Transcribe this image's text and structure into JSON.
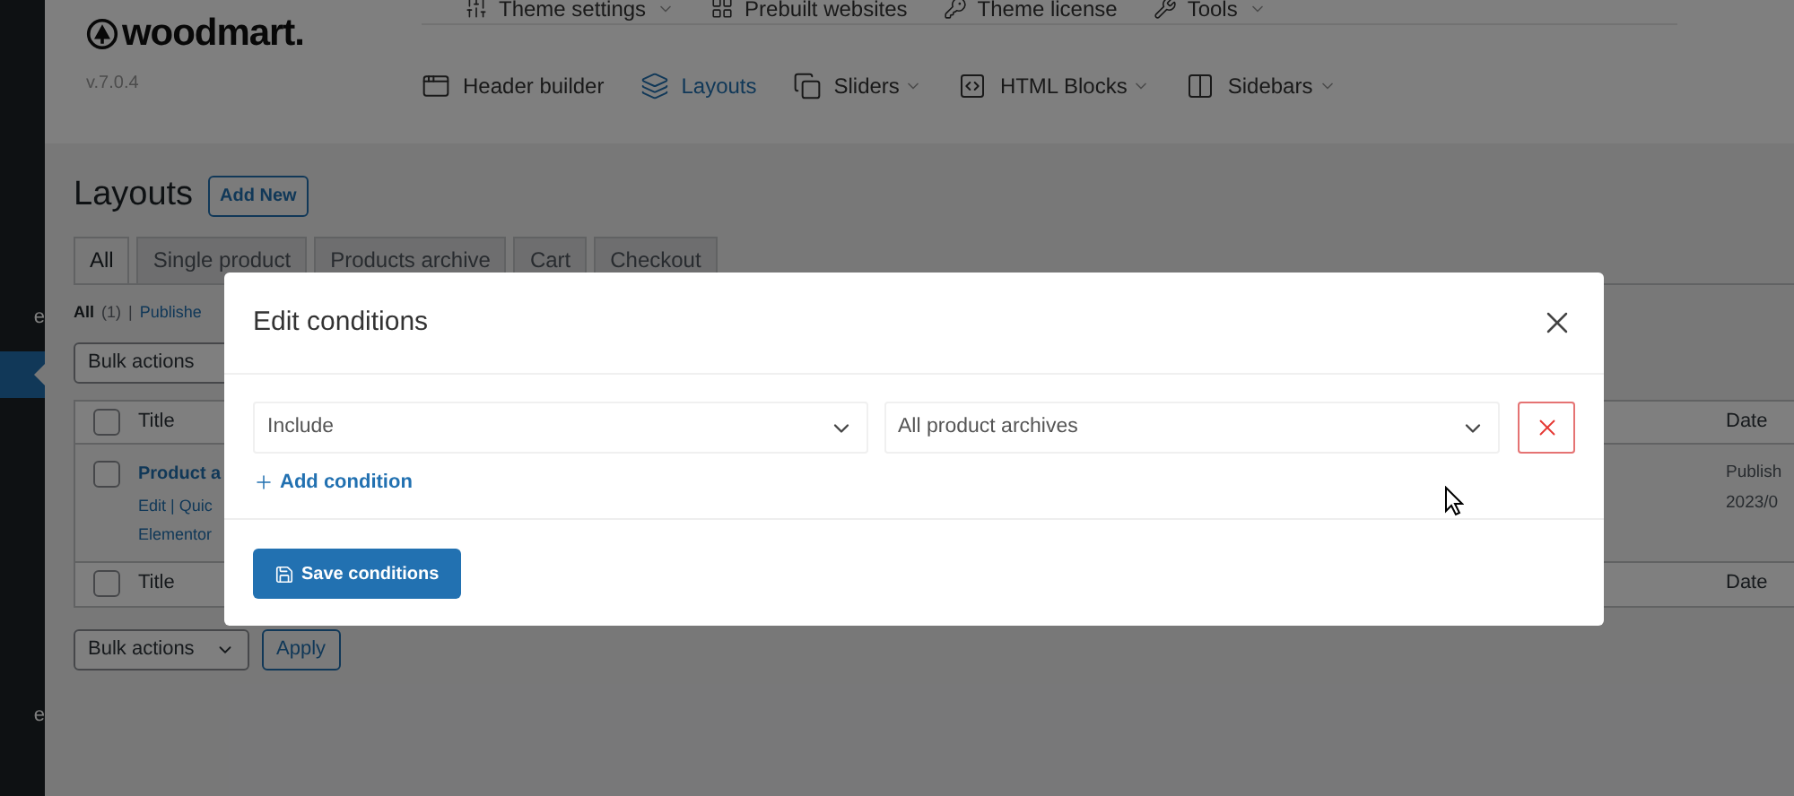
{
  "sidebar": {
    "items": [
      {
        "label": "e",
        "selected": false
      },
      {
        "selected": true
      },
      {
        "label": "e",
        "selected": false
      }
    ]
  },
  "top_menu": [
    {
      "label": "Theme settings",
      "dropdown": true
    },
    {
      "label": "Prebuilt websites",
      "dropdown": false
    },
    {
      "label": "Theme license",
      "dropdown": false
    },
    {
      "label": "Tools",
      "dropdown": true
    }
  ],
  "logo": {
    "name": "woodmart.",
    "version": "v.7.0.4"
  },
  "nav": [
    {
      "label": "Header builder",
      "dropdown": false,
      "selected": false
    },
    {
      "label": "Layouts",
      "dropdown": false,
      "selected": true
    },
    {
      "label": "Sliders",
      "dropdown": true,
      "selected": false
    },
    {
      "label": "HTML Blocks",
      "dropdown": true,
      "selected": false
    },
    {
      "label": "Sidebars",
      "dropdown": true,
      "selected": false
    }
  ],
  "page": {
    "title": "Layouts",
    "add_new": "Add New"
  },
  "tabs": [
    {
      "label": "All",
      "selected": true
    },
    {
      "label": "Single product",
      "selected": false
    },
    {
      "label": "Products archive",
      "selected": false
    },
    {
      "label": "Cart",
      "selected": false
    },
    {
      "label": "Checkout",
      "selected": false
    }
  ],
  "filters": {
    "all": "All",
    "all_count": "(1)",
    "separator": "|",
    "published": "Publishe"
  },
  "bulk_actions_top": "Bulk actions",
  "table": {
    "header": {
      "title": "Title",
      "date": "Date",
      "checked": false
    },
    "rows": [
      {
        "title": "Product a",
        "actions": "Edit | Quic",
        "builder": "Elementor",
        "date_status": "Publish",
        "date": "2023/0",
        "checked": false
      }
    ],
    "footer": {
      "title": "Title",
      "date": "Date",
      "checked": false
    }
  },
  "bulk_actions_bottom": {
    "select": "Bulk actions",
    "apply": "Apply"
  },
  "modal": {
    "title": "Edit conditions",
    "conditions": [
      {
        "type": "Include",
        "value": "All product archives"
      }
    ],
    "add_condition": "Add condition",
    "save": "Save conditions"
  }
}
